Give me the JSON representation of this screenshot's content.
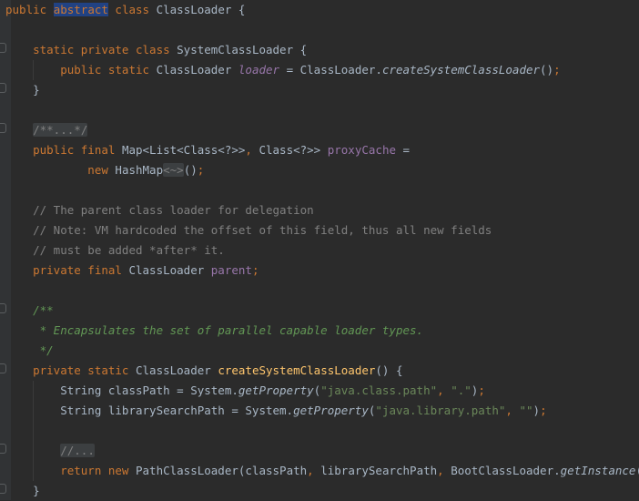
{
  "editor": {
    "lines": [
      {
        "tokens": [
          {
            "t": "public ",
            "c": "kw"
          },
          {
            "t": "abstract",
            "c": "kw sel"
          },
          {
            "t": " class ",
            "c": "kw"
          },
          {
            "t": "ClassLoader {",
            "c": ""
          }
        ]
      },
      {
        "tokens": []
      },
      {
        "tokens": [
          {
            "t": "    static private class ",
            "c": "kw"
          },
          {
            "t": "SystemClassLoader {",
            "c": ""
          }
        ]
      },
      {
        "tokens": [
          {
            "t": "        public static ",
            "c": "kw"
          },
          {
            "t": "ClassLoader ",
            "c": ""
          },
          {
            "t": "loader",
            "c": "fld-i"
          },
          {
            "t": " = ClassLoader.",
            "c": ""
          },
          {
            "t": "createSystemClassLoader",
            "c": "smeth"
          },
          {
            "t": "()",
            "c": ""
          },
          {
            "t": ";",
            "c": "kw"
          }
        ]
      },
      {
        "tokens": [
          {
            "t": "    }",
            "c": ""
          }
        ]
      },
      {
        "tokens": []
      },
      {
        "tokens": [
          {
            "t": "    ",
            "c": ""
          },
          {
            "t": "/**...*/",
            "c": "fold"
          }
        ]
      },
      {
        "tokens": [
          {
            "t": "    public final ",
            "c": "kw"
          },
          {
            "t": "Map<List<Class<?>>",
            "c": ""
          },
          {
            "t": ", ",
            "c": "kw"
          },
          {
            "t": "Class<?>> ",
            "c": ""
          },
          {
            "t": "proxyCache",
            "c": "fld"
          },
          {
            "t": " =",
            "c": ""
          }
        ]
      },
      {
        "tokens": [
          {
            "t": "            new ",
            "c": "kw"
          },
          {
            "t": "HashMap",
            "c": ""
          },
          {
            "t": "<~>",
            "c": "fold"
          },
          {
            "t": "()",
            "c": ""
          },
          {
            "t": ";",
            "c": "kw"
          }
        ]
      },
      {
        "tokens": []
      },
      {
        "tokens": [
          {
            "t": "    // The parent class loader for delegation",
            "c": "com"
          }
        ]
      },
      {
        "tokens": [
          {
            "t": "    // Note: VM hardcoded the offset of this field, thus all new fields",
            "c": "com"
          }
        ]
      },
      {
        "tokens": [
          {
            "t": "    // must be added *after* it.",
            "c": "com"
          }
        ]
      },
      {
        "tokens": [
          {
            "t": "    private final ",
            "c": "kw"
          },
          {
            "t": "ClassLoader ",
            "c": ""
          },
          {
            "t": "parent",
            "c": "fld"
          },
          {
            "t": ";",
            "c": "kw"
          }
        ]
      },
      {
        "tokens": []
      },
      {
        "tokens": [
          {
            "t": "    /**",
            "c": "doc"
          }
        ]
      },
      {
        "tokens": [
          {
            "t": "     * Encapsulates the set of parallel capable loader types.",
            "c": "doc"
          }
        ]
      },
      {
        "tokens": [
          {
            "t": "     */",
            "c": "doc"
          }
        ]
      },
      {
        "tokens": [
          {
            "t": "    private static ",
            "c": "kw"
          },
          {
            "t": "ClassLoader ",
            "c": ""
          },
          {
            "t": "createSystemClassLoader",
            "c": "mth"
          },
          {
            "t": "() {",
            "c": ""
          }
        ]
      },
      {
        "tokens": [
          {
            "t": "        String classPath = System.",
            "c": ""
          },
          {
            "t": "getProperty",
            "c": "smeth"
          },
          {
            "t": "(",
            "c": ""
          },
          {
            "t": "\"java.class.path\"",
            "c": "str"
          },
          {
            "t": ", ",
            "c": "kw"
          },
          {
            "t": "\".\"",
            "c": "str"
          },
          {
            "t": ")",
            "c": ""
          },
          {
            "t": ";",
            "c": "kw"
          }
        ]
      },
      {
        "tokens": [
          {
            "t": "        String librarySearchPath = System.",
            "c": ""
          },
          {
            "t": "getProperty",
            "c": "smeth"
          },
          {
            "t": "(",
            "c": ""
          },
          {
            "t": "\"java.library.path\"",
            "c": "str"
          },
          {
            "t": ", ",
            "c": "kw"
          },
          {
            "t": "\"\"",
            "c": "str"
          },
          {
            "t": ")",
            "c": ""
          },
          {
            "t": ";",
            "c": "kw"
          }
        ]
      },
      {
        "tokens": []
      },
      {
        "tokens": [
          {
            "t": "        ",
            "c": ""
          },
          {
            "t": "//...",
            "c": "fold"
          }
        ]
      },
      {
        "tokens": [
          {
            "t": "        return new ",
            "c": "kw"
          },
          {
            "t": "PathClassLoader(classPath",
            "c": ""
          },
          {
            "t": ", ",
            "c": "kw"
          },
          {
            "t": "librarySearchPath",
            "c": ""
          },
          {
            "t": ", ",
            "c": "kw"
          },
          {
            "t": "BootClassLoader.",
            "c": ""
          },
          {
            "t": "getInstance",
            "c": "smeth"
          },
          {
            "t": "())",
            "c": ""
          },
          {
            "t": ";",
            "c": "kw"
          }
        ]
      },
      {
        "tokens": [
          {
            "t": "    }",
            "c": ""
          }
        ]
      }
    ]
  },
  "colors": {
    "background": "#2b2b2b",
    "keyword": "#cc7832",
    "string": "#6a8759",
    "comment": "#808080",
    "doc_comment": "#629755",
    "field": "#9876aa",
    "method": "#ffc66d",
    "text": "#a9b7c6"
  }
}
